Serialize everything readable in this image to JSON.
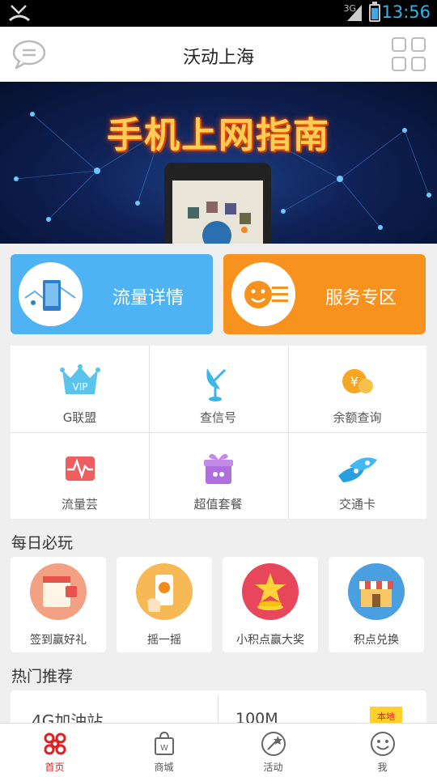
{
  "status_bar": {
    "network": "3G",
    "time": "13:56"
  },
  "header": {
    "title": "沃动上海"
  },
  "banner": {
    "title": "手机上网指南"
  },
  "big_buttons": [
    {
      "label": "流量详情",
      "color": "#4db3f2"
    },
    {
      "label": "服务专区",
      "color": "#f7921e"
    }
  ],
  "services": [
    {
      "label": "G联盟",
      "icon": "vip-crown-icon"
    },
    {
      "label": "查信号",
      "icon": "satellite-dish-icon"
    },
    {
      "label": "余额查询",
      "icon": "yuan-coin-icon"
    },
    {
      "label": "流量芸",
      "icon": "heartbeat-icon"
    },
    {
      "label": "超值套餐",
      "icon": "gift-box-icon"
    },
    {
      "label": "交通卡",
      "icon": "transport-card-icon"
    }
  ],
  "daily": {
    "title": "每日必玩",
    "items": [
      {
        "label": "签到赢好礼",
        "color": "#f2a182"
      },
      {
        "label": "摇一摇",
        "color": "#f7b955"
      },
      {
        "label": "小积点赢大奖",
        "color": "#e8475b"
      },
      {
        "label": "积点兑换",
        "color": "#4a9fe0"
      }
    ]
  },
  "hot": {
    "title": "热门推荐",
    "left": "4G加油站",
    "right": "100M",
    "tag": "本地"
  },
  "tabbar": [
    {
      "label": "首页",
      "active": true
    },
    {
      "label": "商城"
    },
    {
      "label": "活动"
    },
    {
      "label": "我"
    }
  ],
  "colors": {
    "accent_red": "#e02020",
    "status_time": "#33b5e5"
  }
}
